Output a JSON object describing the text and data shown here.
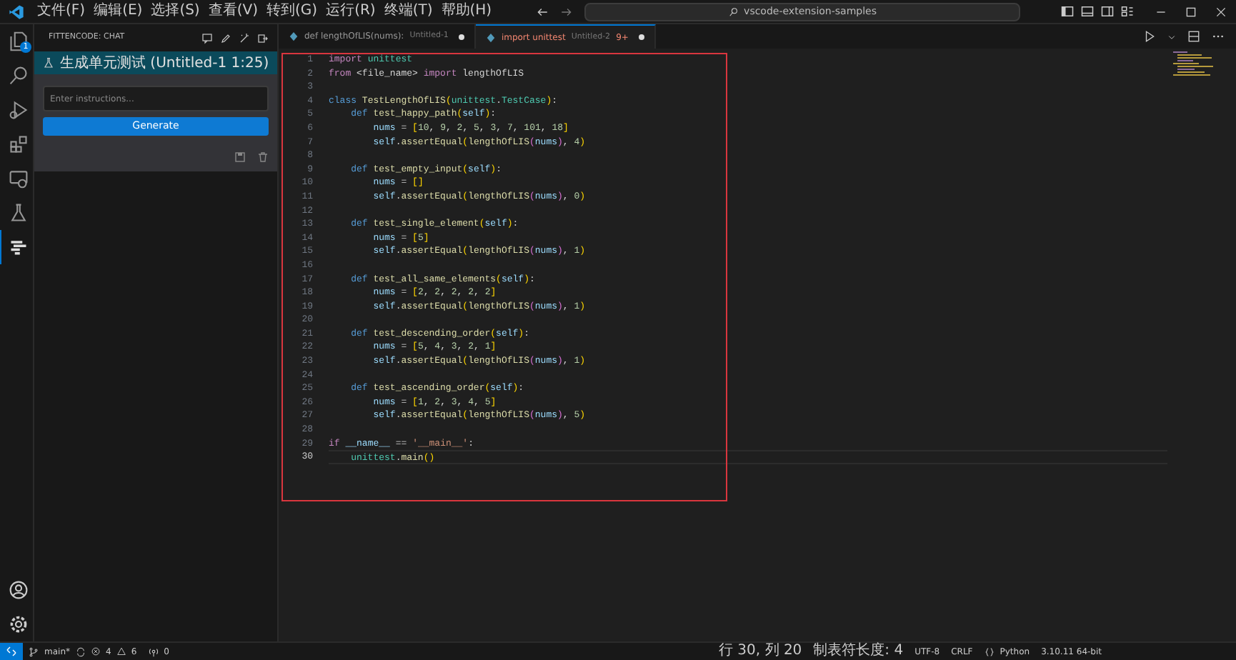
{
  "title_bar": {
    "menu": [
      "文件(F)",
      "编辑(E)",
      "选择(S)",
      "查看(V)",
      "转到(G)",
      "运行(R)",
      "终端(T)",
      "帮助(H)"
    ],
    "search": "vscode-extension-samples"
  },
  "activity_bar": {
    "items": [
      {
        "selected": false,
        "badge": "1"
      },
      {
        "selected": false
      },
      {
        "selected": false
      },
      {
        "selected": false
      },
      {
        "selected": false
      },
      {
        "selected": false
      },
      {
        "selected": true
      }
    ]
  },
  "sidebar": {
    "title": "FITTENCODE: CHAT",
    "task": "生成单元测试 (Untitled-1 1:25)",
    "input": {
      "placeholder": "Enter instructions..."
    },
    "button": "Generate"
  },
  "tabs": [
    {
      "label": "def lengthOfLIS(nums):",
      "detail": "Untitled-1",
      "dirty": true,
      "errors": false,
      "selected": false
    },
    {
      "label": "import unittest",
      "detail": "Untitled-2",
      "problems": "9+",
      "dirty": true,
      "errors": true,
      "selected": true
    }
  ],
  "code": [
    {
      "n": "1",
      "current": false,
      "text": "import unittest"
    },
    {
      "n": "2",
      "current": false,
      "text": "from <file_name> import lengthOfLIS"
    },
    {
      "n": "3",
      "current": false
    },
    {
      "n": "4",
      "current": false,
      "text": "class TestLengthOfLIS(unittest.TestCase):"
    },
    {
      "n": "5",
      "current": false,
      "text": "    def test_happy_path(self):"
    },
    {
      "n": "6",
      "current": false,
      "text": "        nums = [10, 9, 2, 5, 3, 7, 101, 18]"
    },
    {
      "n": "7",
      "current": false,
      "text": "        self.assertEqual(lengthOfLIS(nums), 4)"
    },
    {
      "n": "8",
      "current": false
    },
    {
      "n": "9",
      "current": false,
      "text": "    def test_empty_input(self):"
    },
    {
      "n": "10",
      "current": false,
      "text": "        nums = []"
    },
    {
      "n": "11",
      "current": false,
      "text": "        self.assertEqual(lengthOfLIS(nums), 0)"
    },
    {
      "n": "12",
      "current": false
    },
    {
      "n": "13",
      "current": false,
      "text": "    def test_single_element(self):"
    },
    {
      "n": "14",
      "current": false,
      "text": "        nums = [5]"
    },
    {
      "n": "15",
      "current": false,
      "text": "        self.assertEqual(lengthOfLIS(nums), 1)"
    },
    {
      "n": "16",
      "current": false
    },
    {
      "n": "17",
      "current": false,
      "text": "    def test_all_same_elements(self):"
    },
    {
      "n": "18",
      "current": false,
      "text": "        nums = [2, 2, 2, 2, 2]"
    },
    {
      "n": "19",
      "current": false,
      "text": "        self.assertEqual(lengthOfLIS(nums), 1)"
    },
    {
      "n": "20",
      "current": false
    },
    {
      "n": "21",
      "current": false,
      "text": "    def test_descending_order(self):"
    },
    {
      "n": "22",
      "current": false,
      "text": "        nums = [5, 4, 3, 2, 1]"
    },
    {
      "n": "23",
      "current": false,
      "text": "        self.assertEqual(lengthOfLIS(nums), 1)"
    },
    {
      "n": "24",
      "current": false
    },
    {
      "n": "25",
      "current": false,
      "text": "    def test_ascending_order(self):"
    },
    {
      "n": "26",
      "current": false,
      "text": "        nums = [1, 2, 3, 4, 5]"
    },
    {
      "n": "27",
      "current": false,
      "text": "        self.assertEqual(lengthOfLIS(nums), 5)"
    },
    {
      "n": "28",
      "current": false
    },
    {
      "n": "29",
      "current": false,
      "text": "if __name__ == '__main__':"
    },
    {
      "n": "30",
      "current": true,
      "text": "    unittest.main()"
    }
  ],
  "status_bar": {
    "branch": "main*",
    "errors": "4",
    "warnings": "6",
    "ports": "0",
    "right": [
      {
        "kind": "text",
        "text": "行 30, 列 20"
      },
      {
        "kind": "text",
        "text": "制表符长度: 4"
      },
      {
        "kind": "text",
        "text": "UTF-8"
      },
      {
        "kind": "text",
        "text": "CRLF"
      },
      {
        "kind": "language",
        "text": "Python"
      },
      {
        "kind": "text",
        "text": "3.10.11 64-bit"
      }
    ]
  }
}
